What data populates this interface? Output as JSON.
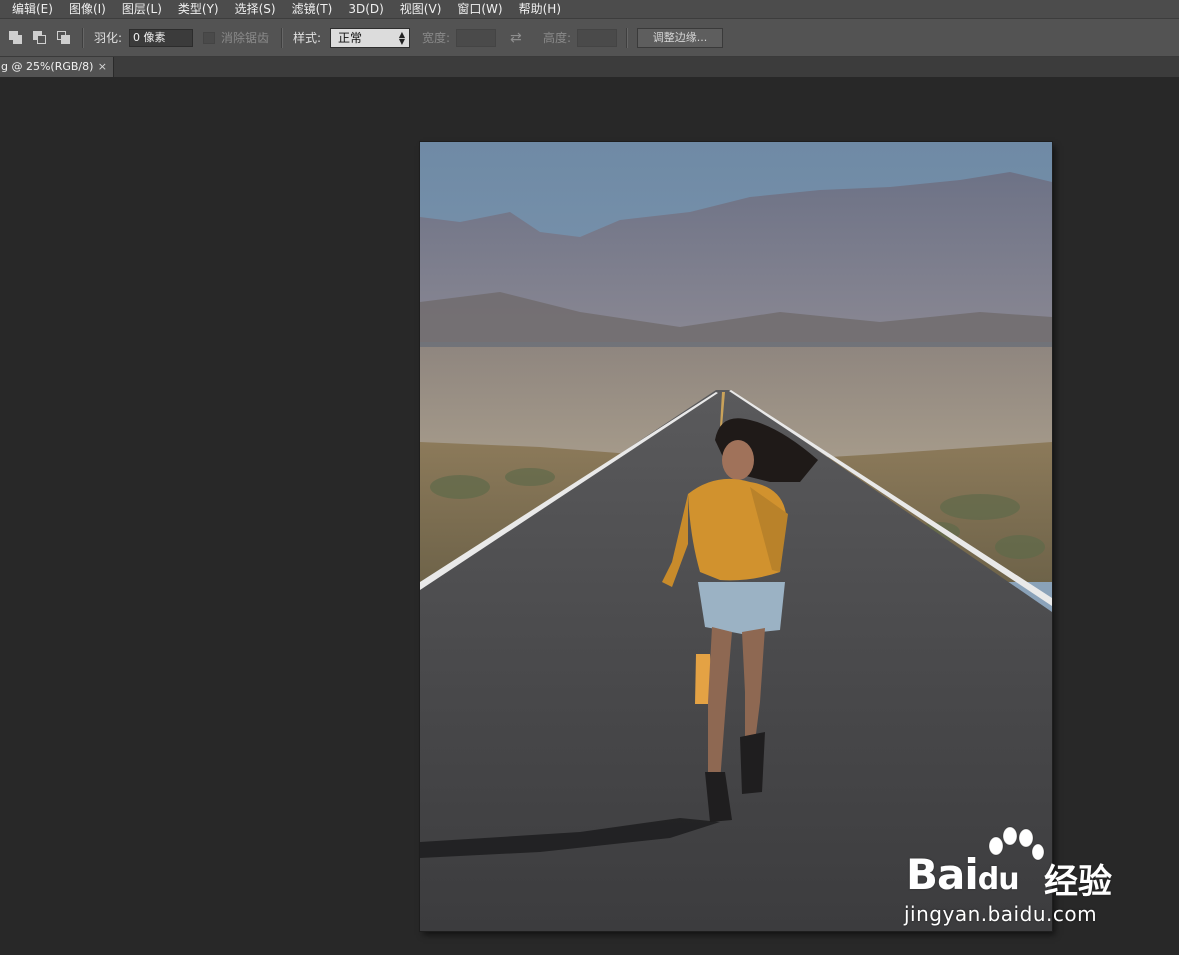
{
  "menubar": {
    "items": [
      "编辑(E)",
      "图像(I)",
      "图层(L)",
      "类型(Y)",
      "选择(S)",
      "滤镜(T)",
      "3D(D)",
      "视图(V)",
      "窗口(W)",
      "帮助(H)"
    ]
  },
  "options_bar": {
    "feather_label": "羽化:",
    "feather_value": "0 像素",
    "antialias_label": "消除锯齿",
    "style_label": "样式:",
    "style_value": "正常",
    "width_label": "宽度:",
    "height_label": "高度:",
    "refine_edge_label": "调整边缘..."
  },
  "document_tab": {
    "title": "g @ 25%(RGB/8)",
    "close_glyph": "×"
  },
  "watermark": {
    "brand": "Bai",
    "brand_suffix": "du",
    "chinese": "经验",
    "url": "jingyan.baidu.com"
  },
  "colors": {
    "app_background": "#282828",
    "menubar": "#4c4c4c",
    "options_bar": "#535353",
    "sweater": "#d1922e"
  }
}
